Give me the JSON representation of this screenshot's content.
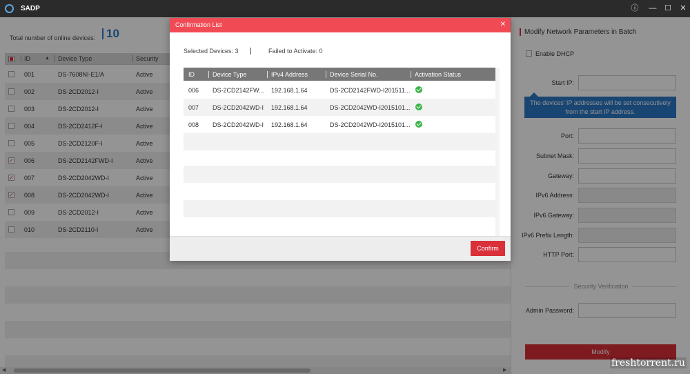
{
  "app": {
    "title": "SADP"
  },
  "window": {
    "info_icon": "ⓘ",
    "min_icon": "—",
    "max_icon": "☐",
    "close_icon": "✕"
  },
  "summary": {
    "label": "Total number of online devices:",
    "count": "10"
  },
  "table": {
    "headers": [
      "ID",
      "Device Type",
      "Security"
    ],
    "sort_icon": "▲",
    "rows": [
      {
        "id": "001",
        "type": "DS-7608NI-E1/A",
        "security": "Active",
        "checked": false
      },
      {
        "id": "002",
        "type": "DS-2CD2012-I",
        "security": "Active",
        "checked": false
      },
      {
        "id": "003",
        "type": "DS-2CD2012-I",
        "security": "Active",
        "checked": false
      },
      {
        "id": "004",
        "type": "DS-2CD2412F-I",
        "security": "Active",
        "checked": false
      },
      {
        "id": "005",
        "type": "DS-2CD2120F-I",
        "security": "Active",
        "checked": false
      },
      {
        "id": "006",
        "type": "DS-2CD2142FWD-I",
        "security": "Active",
        "checked": true
      },
      {
        "id": "007",
        "type": "DS-2CD2042WD-I",
        "security": "Active",
        "checked": true
      },
      {
        "id": "008",
        "type": "DS-2CD2042WD-I",
        "security": "Active",
        "checked": true
      },
      {
        "id": "009",
        "type": "DS-2CD2012-I",
        "security": "Active",
        "checked": false
      },
      {
        "id": "010",
        "type": "DS-2CD2110-I",
        "security": "Active",
        "checked": false
      }
    ],
    "check_mark": "✓"
  },
  "scroll": {
    "left_arrow": "◀",
    "right_arrow": "▶"
  },
  "right_panel": {
    "title": "Modify Network Parameters in Batch",
    "dhcp_label": "Enable DHCP",
    "fields": {
      "start_ip": "Start IP:",
      "port": "Port:",
      "subnet_mask": "Subnet Mask:",
      "gateway": "Gateway:",
      "ipv6_address": "IPv6 Address:",
      "ipv6_gateway": "IPv6 Gateway:",
      "ipv6_prefix": "IPv6 Prefix Length:",
      "http_port": "HTTP Port:",
      "admin_password": "Admin Password:"
    },
    "tooltip_line1": "The devices' IP addresses will be set consecutively",
    "tooltip_line2": "from the start IP address.",
    "security_label": "Security Verification",
    "modify_label": "Modify"
  },
  "modal": {
    "title": "Confirmation List",
    "close_icon": "✕",
    "selected_devices": "Selected Devices: 3",
    "failed_to_activate": "Failed to Activate: 0",
    "headers": [
      "ID",
      "Device Type",
      "IPv4 Address",
      "Device Serial No.",
      "Activation Status"
    ],
    "rows": [
      {
        "id": "006",
        "type": "DS-2CD2142FW...",
        "ip": "192.168.1.64",
        "serial": "DS-2CD2142FWD-I201511...",
        "status": "success"
      },
      {
        "id": "007",
        "type": "DS-2CD2042WD-I",
        "ip": "192.168.1.64",
        "serial": "DS-2CD2042WD-I2015101...",
        "status": "success"
      },
      {
        "id": "008",
        "type": "DS-2CD2042WD-I",
        "ip": "192.168.1.64",
        "serial": "DS-2CD2042WD-I2015101...",
        "status": "success"
      }
    ],
    "confirm_label": "Confirm"
  },
  "watermark": "freshtorrent.ru"
}
